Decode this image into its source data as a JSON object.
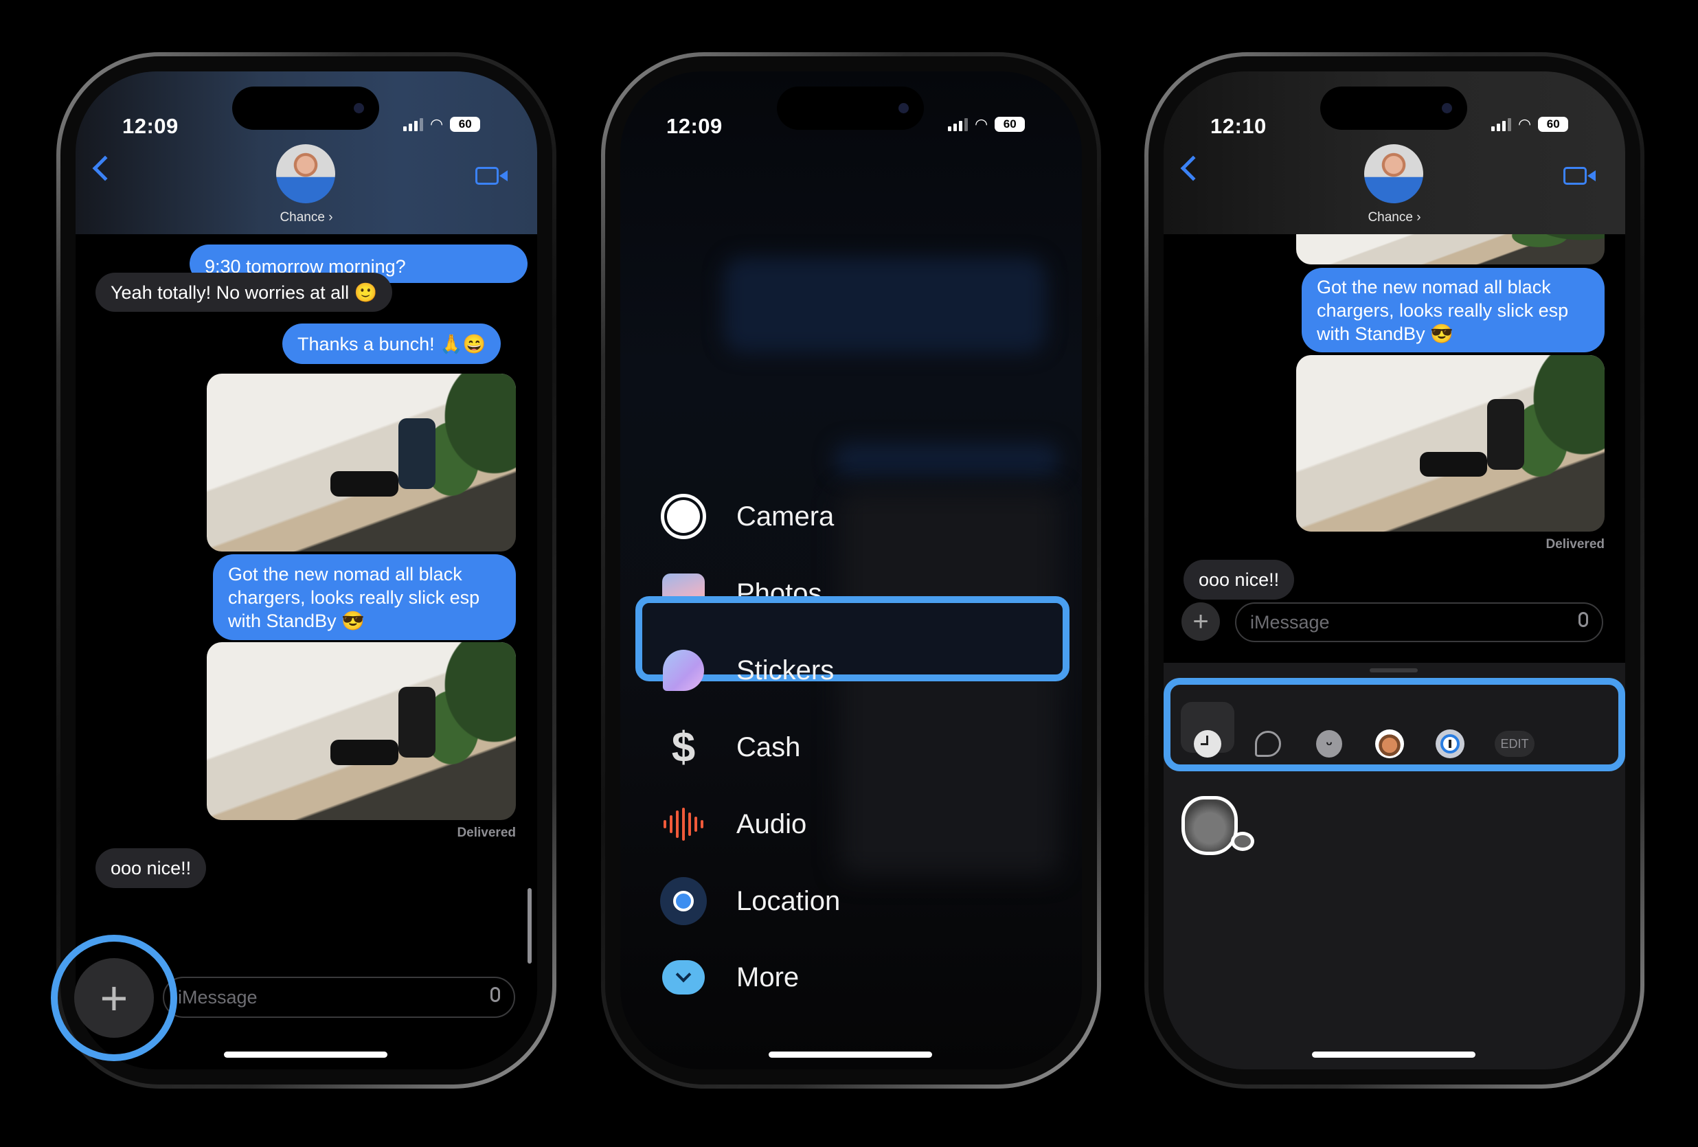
{
  "phones": [
    {
      "status": {
        "time": "12:09",
        "battery": "60"
      },
      "contact": {
        "name": "Chance"
      },
      "messages": [
        {
          "from": "me",
          "text": "9:30 tomorrow morning?"
        },
        {
          "from": "them",
          "text": "Yeah totally! No worries at all 🙂"
        },
        {
          "from": "me",
          "text": "Thanks a bunch! 🙏😄"
        },
        {
          "from": "me",
          "type": "photo"
        },
        {
          "from": "me",
          "text": "Got the new nomad all black chargers, looks really slick esp with StandBy 😎"
        },
        {
          "from": "me",
          "type": "photo"
        },
        {
          "from": "them",
          "text": "ooo nice!!"
        }
      ],
      "delivered": "Delivered",
      "input_placeholder": "iMessage",
      "highlight_color": "#4a9ff0"
    },
    {
      "status": {
        "time": "12:09",
        "battery": "60"
      },
      "menu": [
        {
          "icon": "camera-icon",
          "label": "Camera"
        },
        {
          "icon": "photos-icon",
          "label": "Photos"
        },
        {
          "icon": "stickers-icon",
          "label": "Stickers",
          "highlighted": true
        },
        {
          "icon": "cash-icon",
          "label": "Cash"
        },
        {
          "icon": "audio-icon",
          "label": "Audio"
        },
        {
          "icon": "location-icon",
          "label": "Location"
        },
        {
          "icon": "more-icon",
          "label": "More"
        }
      ]
    },
    {
      "status": {
        "time": "12:10",
        "battery": "60"
      },
      "contact": {
        "name": "Chance"
      },
      "messages": [
        {
          "from": "me",
          "type": "photo"
        },
        {
          "from": "me",
          "text": "Got the new nomad all black chargers, looks really slick esp with StandBy 😎"
        },
        {
          "from": "me",
          "type": "photo"
        },
        {
          "from": "them",
          "text": "ooo nice!!"
        }
      ],
      "delivered": "Delivered",
      "input_placeholder": "iMessage",
      "sticker_tabs": [
        "recents-icon",
        "stickers-icon",
        "emoji-icon",
        "memoji-icon",
        "1password-icon"
      ],
      "edit_label": "EDIT"
    }
  ]
}
